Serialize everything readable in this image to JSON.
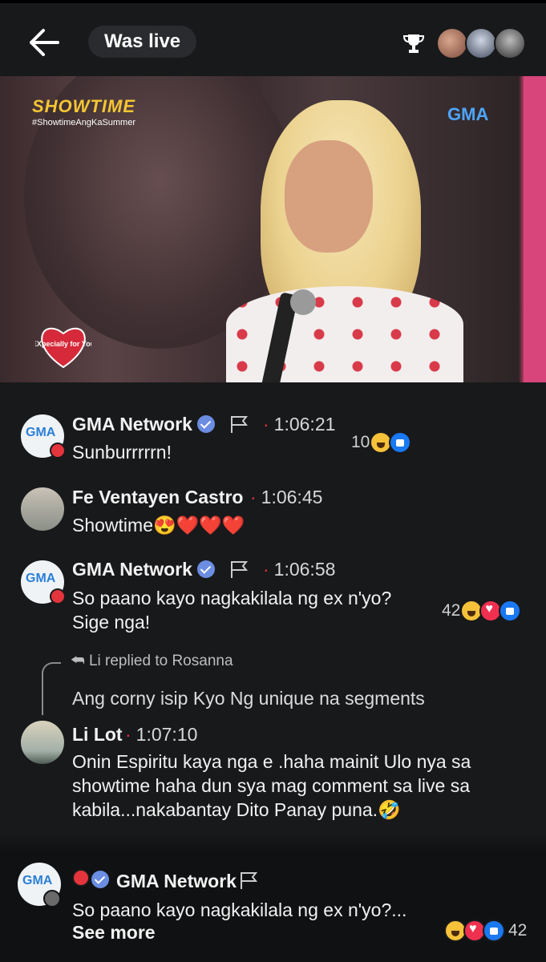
{
  "header": {
    "live_label": "Was live"
  },
  "video": {
    "show_logo": "SHOWTIME",
    "hashtag": "#ShowtimeAngKaSummer",
    "network_logo": "GMA",
    "badge_text": "EXpecially for You"
  },
  "comments": [
    {
      "author": "GMA Network",
      "verified": true,
      "time": "1:06:21",
      "text": "Sunburrrrrn!",
      "reaction_count": "10"
    },
    {
      "author": "Fe Ventayen Castro",
      "verified": false,
      "time": "1:06:45",
      "text": "Showtime😍❤️❤️❤️"
    },
    {
      "author": "GMA Network",
      "verified": true,
      "time": "1:06:58",
      "text_line1": "So paano kayo nagkakilala ng ex n'yo?",
      "text_line2": "Sige nga!",
      "reaction_count": "42"
    }
  ],
  "reply": {
    "reply_tag": "Li replied to Rosanna",
    "quoted_text": "Ang corny isip Kyo Ng unique na segments",
    "author": "Li Lot",
    "time": "1:07:10",
    "text_line1": "Onin Espiritu kaya nga e .haha mainit Ulo nya sa",
    "text_line2": "showtime haha dun sya mag comment sa live sa",
    "text_line3": "kabila...nakabantay Dito Panay puna.🤣"
  },
  "pinned": {
    "author": "GMA Network",
    "text": "So paano kayo nagkakilala ng ex n'yo?...",
    "see_more": "See more",
    "reaction_count": "42"
  },
  "colors": {
    "background": "#18191b",
    "live_red": "#e4343c",
    "verified_blue": "#6b8de2",
    "like_blue": "#1a78f2"
  }
}
